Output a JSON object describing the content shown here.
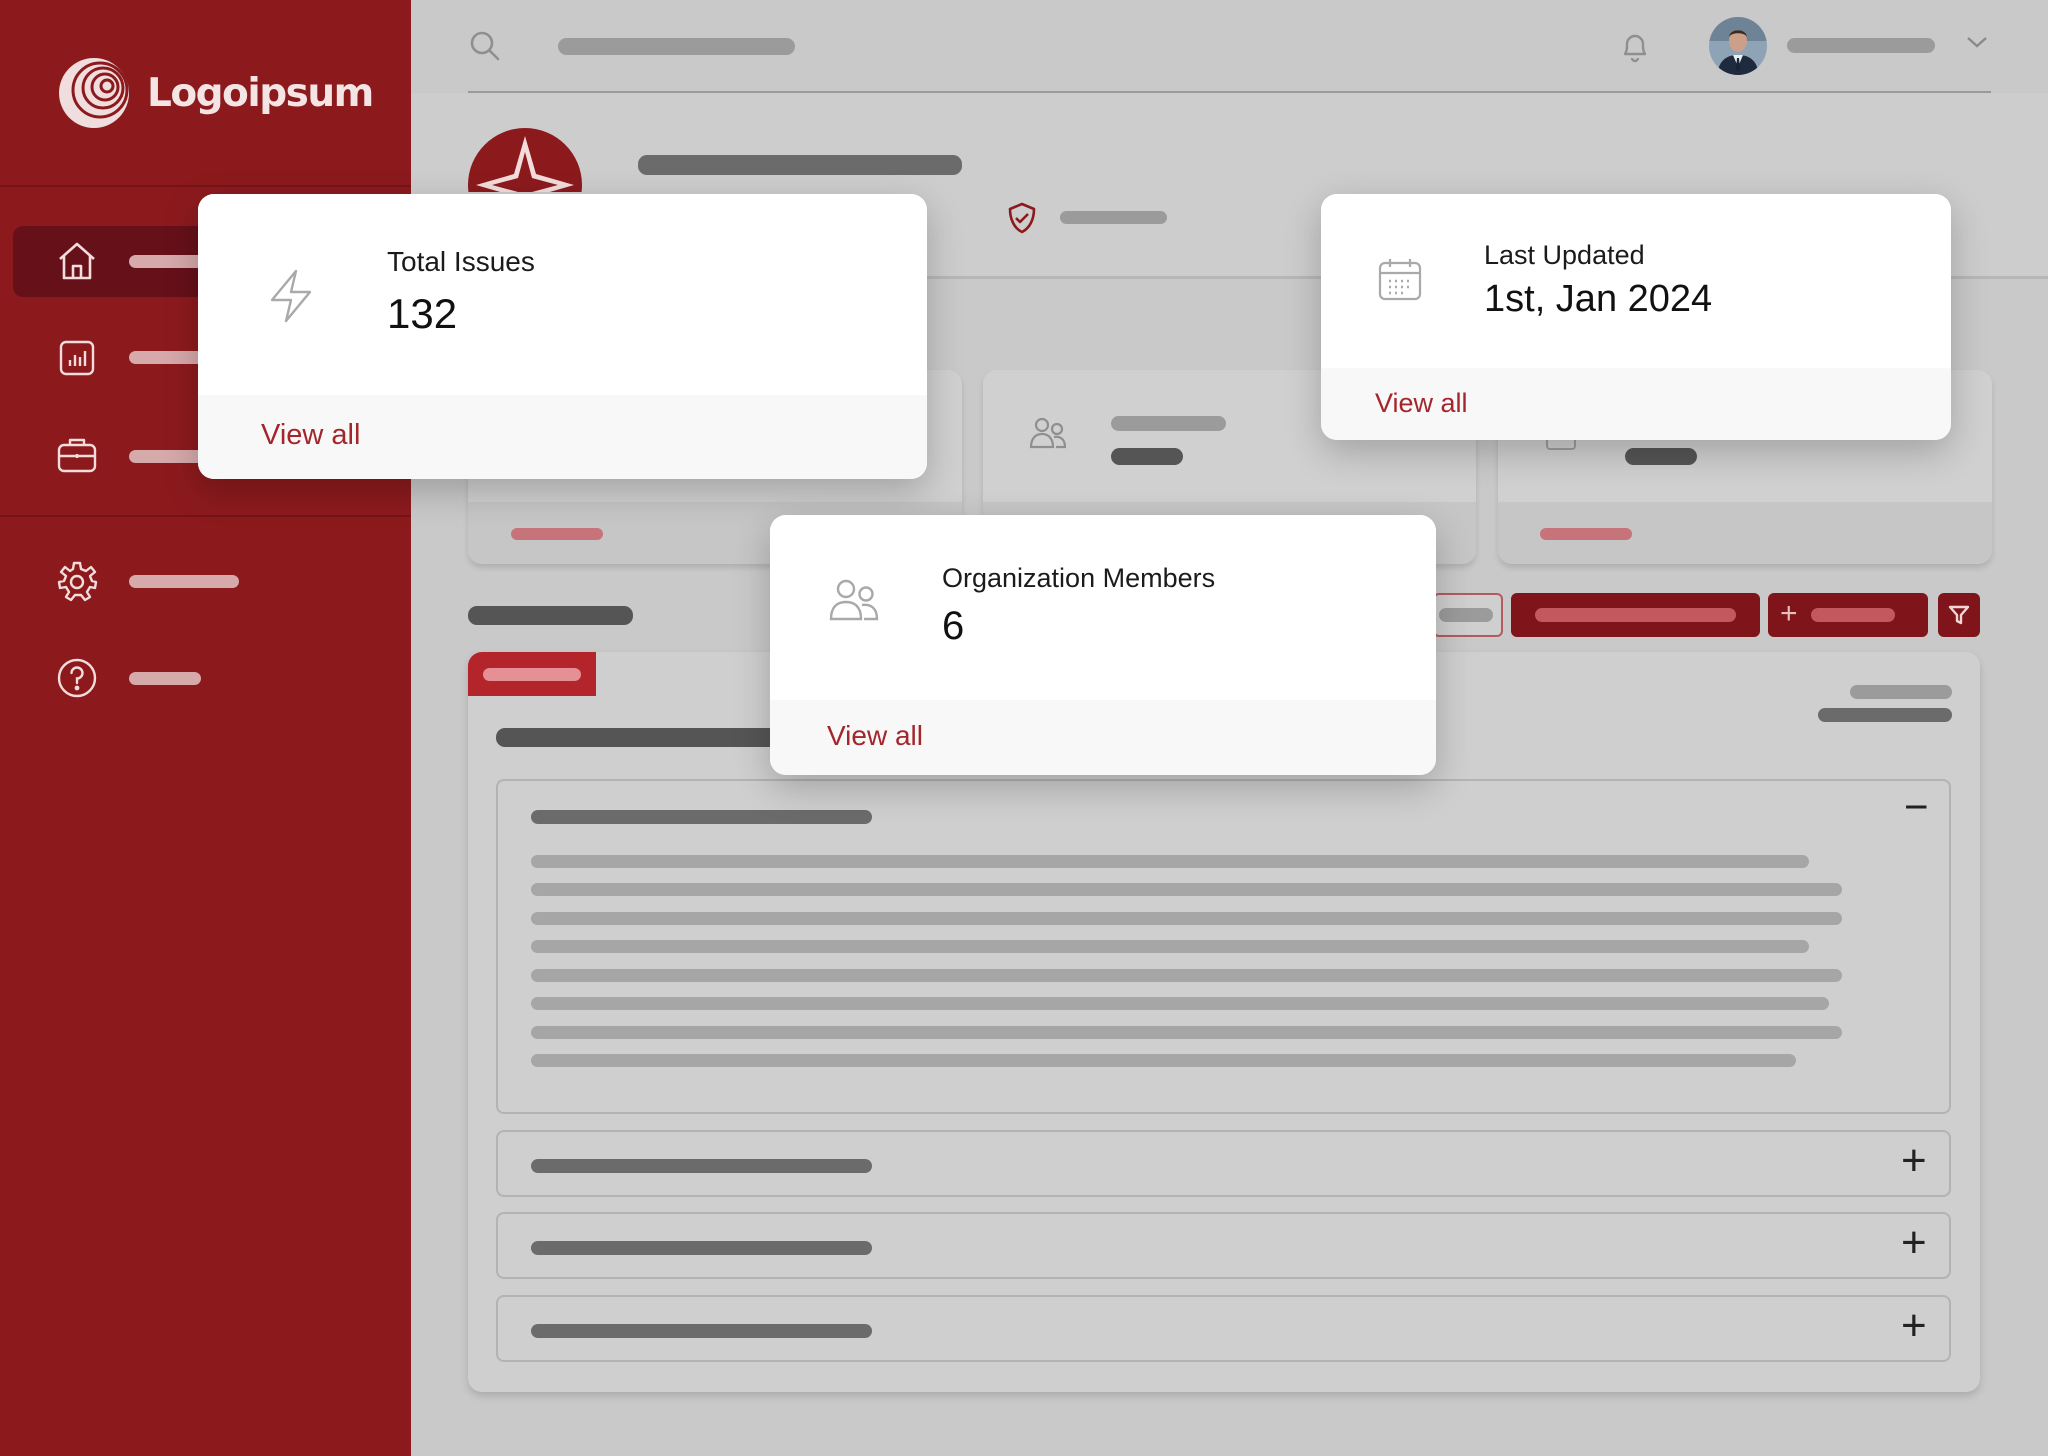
{
  "brand": {
    "name": "Logoipsum",
    "primary_color": "#8c1a1d",
    "accent_red": "#a3262c"
  },
  "sidebar": {
    "items": [
      {
        "icon": "home-icon",
        "active": true
      },
      {
        "icon": "chart-icon",
        "active": false
      },
      {
        "icon": "briefcase-icon",
        "active": false
      },
      {
        "icon": "gear-icon",
        "active": false
      },
      {
        "icon": "help-icon",
        "active": false
      }
    ]
  },
  "header": {
    "icons": [
      "search-icon",
      "bell-icon",
      "avatar",
      "chevron-down-icon"
    ]
  },
  "cards": {
    "total_issues": {
      "label": "Total Issues",
      "value": "132",
      "link": "View all",
      "icon": "lightning-icon"
    },
    "last_updated": {
      "label": "Last Updated",
      "value": "1st, Jan 2024",
      "link": "View all",
      "icon": "calendar-icon"
    },
    "org_members": {
      "label": "Organization Members",
      "value": "6",
      "link": "View all",
      "icon": "users-icon"
    }
  },
  "toolbar": {
    "add_symbol": "+",
    "icons": [
      "plus-icon",
      "filter-icon"
    ]
  },
  "accordion": {
    "sections": [
      {
        "expanded": true,
        "toggle": "−"
      },
      {
        "expanded": false,
        "toggle": "+"
      },
      {
        "expanded": false,
        "toggle": "+"
      },
      {
        "expanded": false,
        "toggle": "+"
      }
    ]
  }
}
